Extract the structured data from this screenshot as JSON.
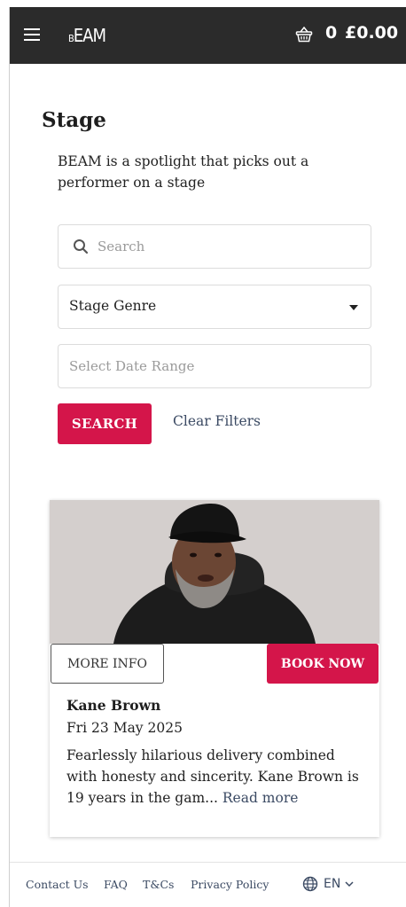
{
  "header": {
    "logo_small": "B",
    "logo_main": "EAM",
    "cart_count": "0",
    "cart_total": "£0.00"
  },
  "page": {
    "title": "Stage",
    "intro": "BEAM is a spotlight that picks out a performer on a stage"
  },
  "filters": {
    "search_placeholder": "Search",
    "genre_selected": "Stage Genre",
    "date_placeholder": "Select Date Range",
    "search_button": "SEARCH",
    "clear_filters": "Clear Filters"
  },
  "event": {
    "more_info": "MORE INFO",
    "book_now": "BOOK NOW",
    "name": "Kane Brown",
    "date": "Fri 23 May 2025",
    "description": "Fearlessly hilarious delivery combined with honesty and sincerity. Kane Brown is 19 years in the gam...",
    "read_more": "Read more"
  },
  "footer": {
    "links": [
      "Contact Us",
      "FAQ",
      "T&Cs",
      "Privacy Policy"
    ],
    "language": "EN"
  },
  "colors": {
    "header_bg": "#2b2b2b",
    "accent": "#d4154a",
    "link": "#3b4a63"
  },
  "icons": [
    "hamburger-menu-icon",
    "basket-icon",
    "search-icon",
    "caret-down-icon",
    "globe-icon",
    "chevron-down-icon"
  ]
}
